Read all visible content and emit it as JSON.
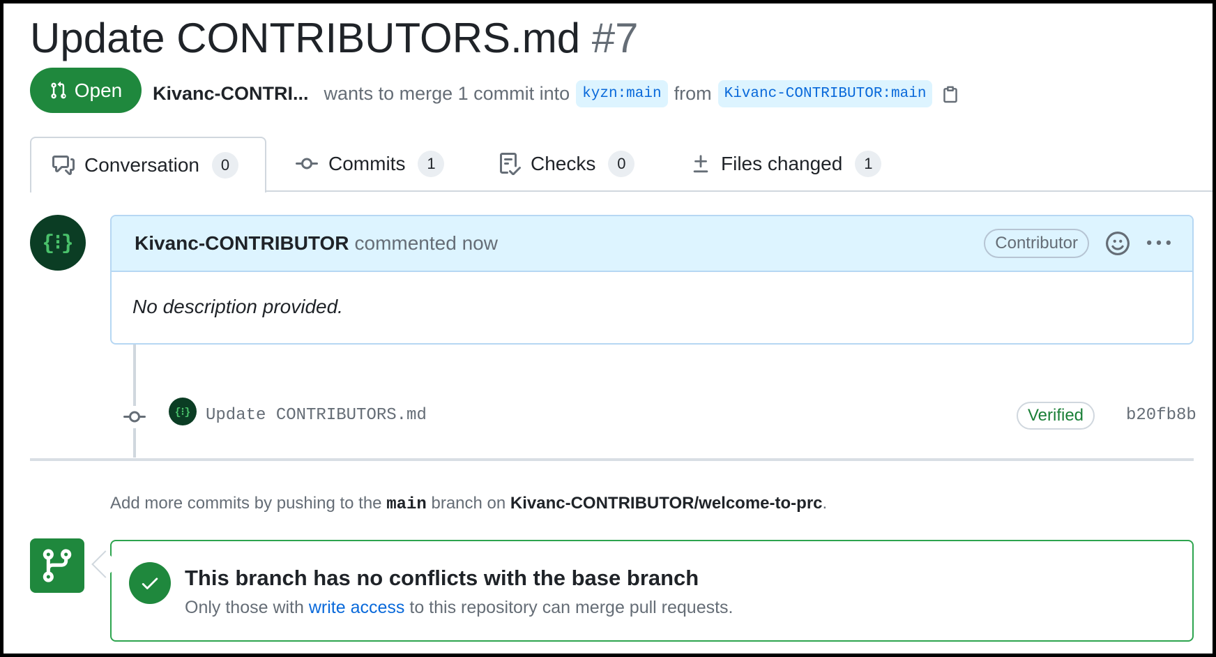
{
  "pr": {
    "title": "Update CONTRIBUTORS.md",
    "number": "#7",
    "state": "Open",
    "author": "Kivanc-CONTRI...",
    "merge_text": "wants to merge 1 commit into",
    "base_branch": "kyzn:main",
    "from_text": "from",
    "head_branch": "Kivanc-CONTRIBUTOR:main"
  },
  "tabs": [
    {
      "label": "Conversation",
      "count": "0"
    },
    {
      "label": "Commits",
      "count": "1"
    },
    {
      "label": "Checks",
      "count": "0"
    },
    {
      "label": "Files changed",
      "count": "1"
    }
  ],
  "comment": {
    "author": "Kivanc-CONTRIBUTOR",
    "action": "commented now",
    "role_badge": "Contributor",
    "body": "No description provided."
  },
  "commit": {
    "message": "Update CONTRIBUTORS.md",
    "verified_label": "Verified",
    "sha": "b20fb8b"
  },
  "hint": {
    "prefix": "Add more commits by pushing to the",
    "branch": "main",
    "middle": "branch on",
    "repo": "Kivanc-CONTRIBUTOR/welcome-to-prc",
    "suffix": "."
  },
  "merge": {
    "title": "This branch has no conflicts with the base branch",
    "sub_prefix": "Only those with",
    "sub_link": "write access",
    "sub_suffix": "to this repository can merge pull requests."
  },
  "avatar_glyph": "{⁝}",
  "colors": {
    "open_green": "#1f883d",
    "link_blue": "#0969da",
    "comment_header_bg": "#ddf4ff"
  }
}
